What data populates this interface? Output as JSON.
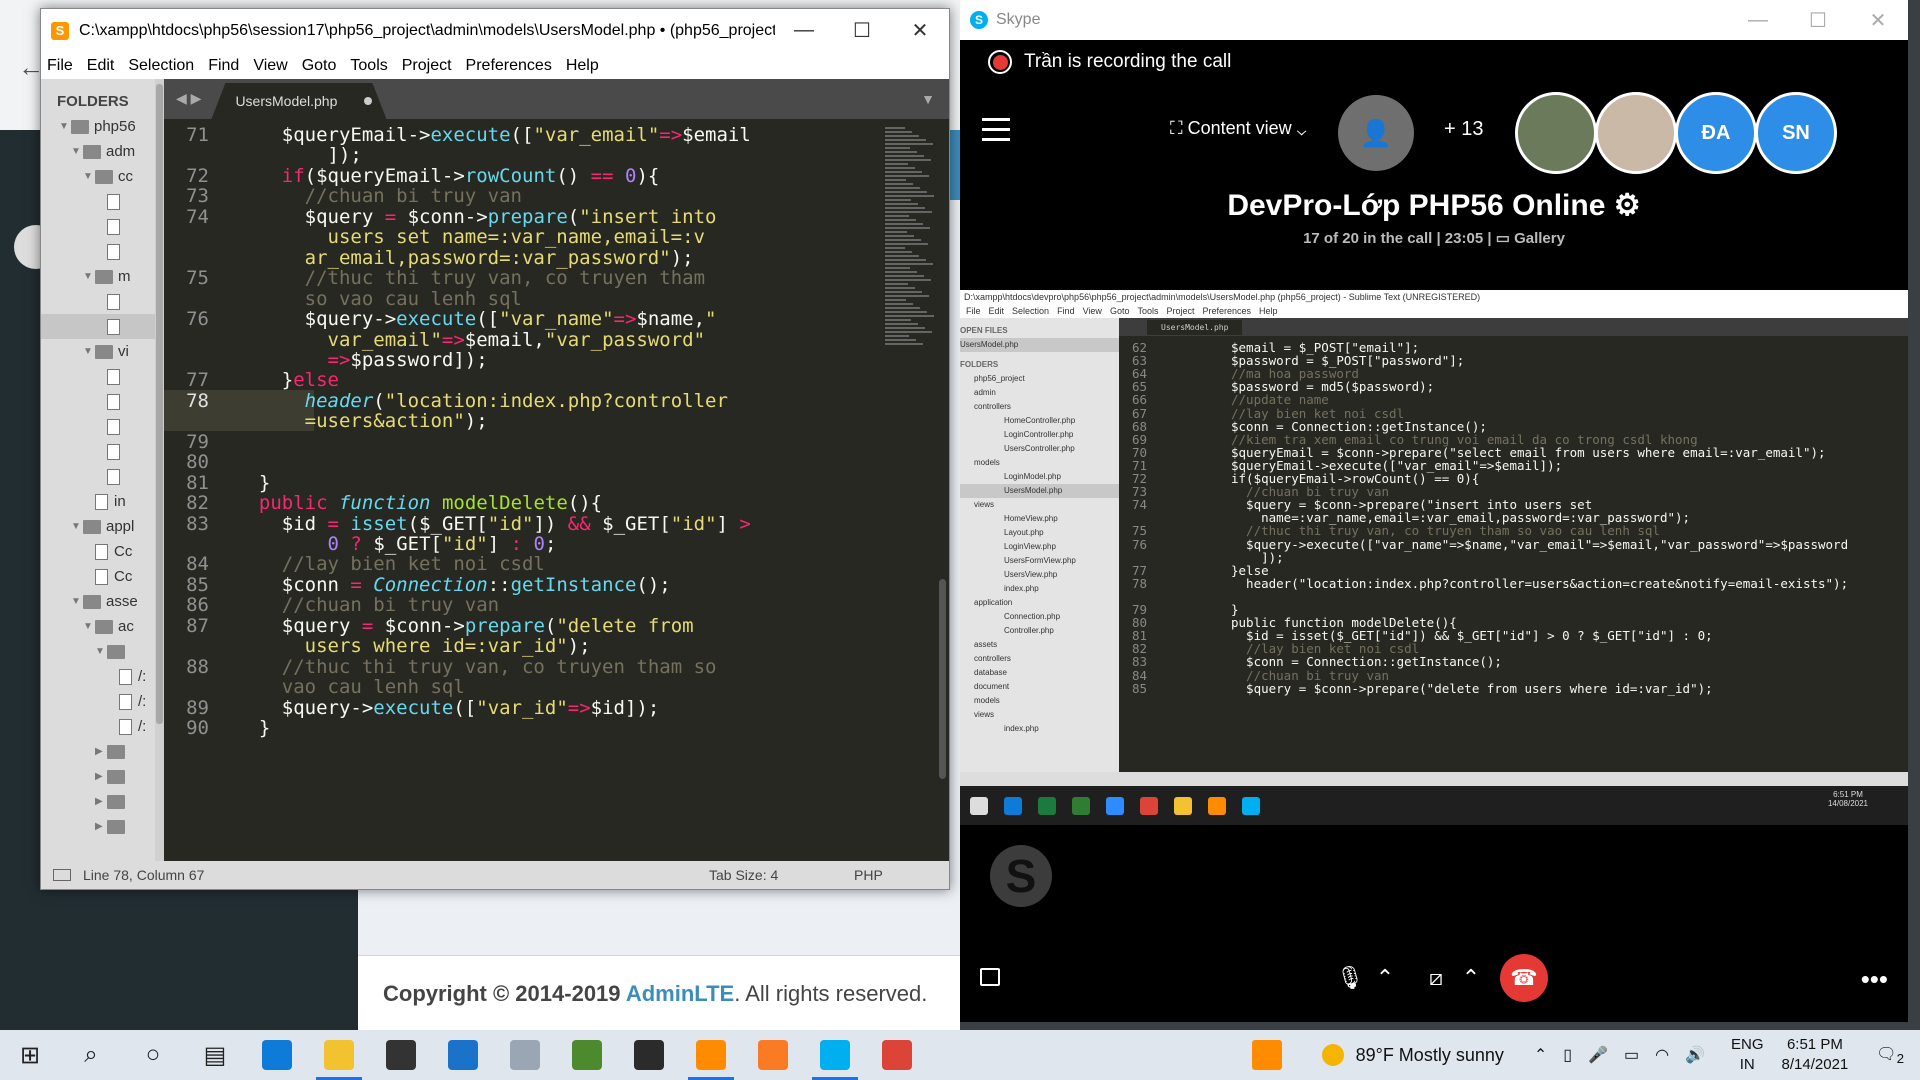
{
  "background_page": {
    "footer_copyright": "Copyright © 2014-2019",
    "footer_brand": "AdminLTE",
    "footer_rest": ". All rights reserved."
  },
  "sublime": {
    "title": "C:\\xampp\\htdocs\\php56\\session17\\php56_project\\admin\\models\\UsersModel.php • (php56_project) - S...",
    "menu": [
      "File",
      "Edit",
      "Selection",
      "Find",
      "View",
      "Goto",
      "Tools",
      "Project",
      "Preferences",
      "Help"
    ],
    "folders_label": "FOLDERS",
    "tree": [
      {
        "label": "php56",
        "type": "folder",
        "depth": 0,
        "open": true
      },
      {
        "label": "adm",
        "type": "folder",
        "depth": 1,
        "open": true
      },
      {
        "label": "cc",
        "type": "folder",
        "depth": 2,
        "open": true
      },
      {
        "label": "",
        "type": "file",
        "depth": 3
      },
      {
        "label": "",
        "type": "file",
        "depth": 3
      },
      {
        "label": "",
        "type": "file",
        "depth": 3
      },
      {
        "label": "m",
        "type": "folder",
        "depth": 2,
        "open": true
      },
      {
        "label": "",
        "type": "file",
        "depth": 3
      },
      {
        "label": "",
        "type": "file",
        "depth": 3,
        "selected": true
      },
      {
        "label": "vi",
        "type": "folder",
        "depth": 2,
        "open": true
      },
      {
        "label": "",
        "type": "file",
        "depth": 3
      },
      {
        "label": "",
        "type": "file",
        "depth": 3
      },
      {
        "label": "",
        "type": "file",
        "depth": 3
      },
      {
        "label": "",
        "type": "file",
        "depth": 3
      },
      {
        "label": "",
        "type": "file",
        "depth": 3
      },
      {
        "label": "in",
        "type": "file",
        "depth": 2
      },
      {
        "label": "appl",
        "type": "folder",
        "depth": 1,
        "open": true
      },
      {
        "label": "Cc",
        "type": "file",
        "depth": 2
      },
      {
        "label": "Cc",
        "type": "file",
        "depth": 2
      },
      {
        "label": "asse",
        "type": "folder",
        "depth": 1,
        "open": true
      },
      {
        "label": "ac",
        "type": "folder",
        "depth": 2,
        "open": true
      },
      {
        "label": "",
        "type": "folder",
        "depth": 3,
        "open": true
      },
      {
        "label": "/:",
        "type": "file",
        "depth": 4
      },
      {
        "label": "/:",
        "type": "file",
        "depth": 4
      },
      {
        "label": "/:",
        "type": "file",
        "depth": 4
      },
      {
        "label": "",
        "type": "folder",
        "depth": 3,
        "open": false
      },
      {
        "label": "",
        "type": "folder",
        "depth": 3,
        "open": false
      },
      {
        "label": "",
        "type": "folder",
        "depth": 3,
        "open": false
      },
      {
        "label": "",
        "type": "folder",
        "depth": 3,
        "open": false
      }
    ],
    "tab_label": "UsersModel.php",
    "status_position": "Line 78, Column 67",
    "status_tab_size": "Tab Size: 4",
    "status_syntax": "PHP",
    "code_lines": [
      {
        "ln": "71",
        "html": "    $queryEmail-><span class=\"f\">execute</span>([<span class=\"s\">\"var_email\"</span><span class=\"k\">=></span>$email"
      },
      {
        "ln": "",
        "html": "        ]);"
      },
      {
        "ln": "72",
        "html": "    <span class=\"k\">if</span>($queryEmail-><span class=\"f\">rowCount</span>() <span class=\"k\">==</span> <span class=\"n\">0</span>){"
      },
      {
        "ln": "73",
        "html": "      <span class=\"c\">//chuan bi truy van</span>"
      },
      {
        "ln": "74",
        "html": "      $query <span class=\"k\">=</span> $conn-><span class=\"f\">prepare</span>(<span class=\"s\">\"insert into</span>"
      },
      {
        "ln": "",
        "html": "<span class=\"s\">        users set name=:var_name,email=:v</span>"
      },
      {
        "ln": "",
        "html": "<span class=\"s\">      ar_email,password=:var_password\"</span>);"
      },
      {
        "ln": "75",
        "html": "      <span class=\"c\">//thuc thi truy van, co truyen tham</span>"
      },
      {
        "ln": "",
        "html": "<span class=\"c\">      so vao cau lenh sql</span>"
      },
      {
        "ln": "76",
        "html": "      $query-><span class=\"f\">execute</span>([<span class=\"s\">\"var_name\"</span><span class=\"k\">=></span>$name,<span class=\"s\">\"</span>"
      },
      {
        "ln": "",
        "html": "<span class=\"s\">        var_email\"</span><span class=\"k\">=></span>$email,<span class=\"s\">\"var_password\"</span>"
      },
      {
        "ln": "",
        "html": "        <span class=\"k\">=></span>$password]);"
      },
      {
        "ln": "77",
        "html": "    }<span class=\"k\">else</span>"
      },
      {
        "ln": "78",
        "html": "      <span class=\"fi\">header</span>(<span class=\"s\">\"location:index.php?controller</span>"
      },
      {
        "ln": "",
        "html": "<span class=\"s\">      =users&amp;action\"</span>);"
      },
      {
        "ln": "79",
        "html": ""
      },
      {
        "ln": "80",
        "html": ""
      },
      {
        "ln": "81",
        "html": "  }"
      },
      {
        "ln": "82",
        "html": "  <span class=\"k\">public</span> <span class=\"fi\">function</span> <span class=\"fn\">modelDelete</span>(){"
      },
      {
        "ln": "83",
        "html": "    $id <span class=\"k\">=</span> <span class=\"f\">isset</span>($_GET[<span class=\"s\">\"id\"</span>]) <span class=\"k\">&amp;&amp;</span> $_GET[<span class=\"s\">\"id\"</span>] <span class=\"k\">></span>"
      },
      {
        "ln": "",
        "html": "        <span class=\"n\">0</span> <span class=\"k\">?</span> $_GET[<span class=\"s\">\"id\"</span>] <span class=\"k\">:</span> <span class=\"n\">0</span>;"
      },
      {
        "ln": "84",
        "html": "    <span class=\"c\">//lay bien ket noi csdl</span>"
      },
      {
        "ln": "85",
        "html": "    $conn <span class=\"k\">=</span> <span class=\"cls\">Connection</span>::<span class=\"f\">getInstance</span>();"
      },
      {
        "ln": "86",
        "html": "    <span class=\"c\">//chuan bi truy van</span>"
      },
      {
        "ln": "87",
        "html": "    $query <span class=\"k\">=</span> $conn-><span class=\"f\">prepare</span>(<span class=\"s\">\"delete from</span>"
      },
      {
        "ln": "",
        "html": "<span class=\"s\">      users where id=:var_id\"</span>);"
      },
      {
        "ln": "88",
        "html": "    <span class=\"c\">//thuc thi truy van, co truyen tham so</span>"
      },
      {
        "ln": "",
        "html": "<span class=\"c\">    vao cau lenh sql</span>"
      },
      {
        "ln": "89",
        "html": "    $query-><span class=\"f\">execute</span>([<span class=\"s\">\"var_id\"</span><span class=\"k\">=></span>$id]);"
      },
      {
        "ln": "90",
        "html": "  }"
      }
    ]
  },
  "skype": {
    "title": "Skype",
    "recording_text": "Trần is recording the call",
    "content_view_label": "Content view",
    "participants_more": "+ 13",
    "avatars": [
      {
        "initials": "",
        "color": "#6b7a5a"
      },
      {
        "initials": "",
        "color": "#c9b9a6"
      },
      {
        "initials": "ĐA",
        "color": "#2e8de6"
      },
      {
        "initials": "SN",
        "color": "#2e8de6"
      }
    ],
    "meeting_title": "DevPro-Lớp PHP56 Online",
    "meeting_status": "17 of 20 in the call | 23:05 |",
    "meeting_view": "Gallery",
    "shared_screen": {
      "title": "D:\\xampp\\htdocs\\devpro\\php56\\php56_project\\admin\\models\\UsersModel.php (php56_project) - Sublime Text (UNREGISTERED)",
      "menu": [
        "File",
        "Edit",
        "Selection",
        "Find",
        "View",
        "Goto",
        "Tools",
        "Project",
        "Preferences",
        "Help"
      ],
      "open_files_label": "OPEN FILES",
      "open_file": "UsersModel.php",
      "folders_label": "FOLDERS",
      "tree": [
        "php56_project",
        "admin",
        "controllers",
        "HomeController.php",
        "LoginController.php",
        "UsersController.php",
        "models",
        "LoginModel.php",
        "UsersModel.php",
        "views",
        "HomeView.php",
        "Layout.php",
        "LoginView.php",
        "UsersFormView.php",
        "UsersView.php",
        "index.php",
        "application",
        "Connection.php",
        "Controller.php",
        "assets",
        "controllers",
        "database",
        "document",
        "models",
        "views",
        "index.php"
      ],
      "tab_label": "UsersModel.php",
      "clock_time": "6:51 PM",
      "clock_date": "14/08/2021",
      "code_lines": [
        {
          "ln": "62",
          "text": "$email = $_POST[\"email\"];"
        },
        {
          "ln": "63",
          "text": "$password = $_POST[\"password\"];"
        },
        {
          "ln": "64",
          "text": "//ma hoa password"
        },
        {
          "ln": "65",
          "text": "$password = md5($password);"
        },
        {
          "ln": "66",
          "text": "//update name"
        },
        {
          "ln": "67",
          "text": "//lay bien ket noi csdl"
        },
        {
          "ln": "68",
          "text": "$conn = Connection::getInstance();"
        },
        {
          "ln": "69",
          "text": "//kiem tra xem email co trung voi email da co trong csdl khong"
        },
        {
          "ln": "70",
          "text": "$queryEmail = $conn->prepare(\"select email from users where email=:var_email\");"
        },
        {
          "ln": "71",
          "text": "$queryEmail->execute([\"var_email\"=>$email]);"
        },
        {
          "ln": "72",
          "text": "if($queryEmail->rowCount() == 0){"
        },
        {
          "ln": "73",
          "text": "  //chuan bi truy van"
        },
        {
          "ln": "74",
          "text": "  $query = $conn->prepare(\"insert into users set"
        },
        {
          "ln": "",
          "text": "    name=:var_name,email=:var_email,password=:var_password\");"
        },
        {
          "ln": "75",
          "text": "  //thuc thi truy van, co truyen tham so vao cau lenh sql"
        },
        {
          "ln": "76",
          "text": "  $query->execute([\"var_name\"=>$name,\"var_email\"=>$email,\"var_password\"=>$password"
        },
        {
          "ln": "",
          "text": "    ]);"
        },
        {
          "ln": "77",
          "text": "}else"
        },
        {
          "ln": "78",
          "text": "  header(\"location:index.php?controller=users&action=create&notify=email-exists\");"
        },
        {
          "ln": "",
          "text": ""
        },
        {
          "ln": "79",
          "text": "}"
        },
        {
          "ln": "80",
          "text": "public function modelDelete(){"
        },
        {
          "ln": "81",
          "text": "  $id = isset($_GET[\"id\"]) && $_GET[\"id\"] > 0 ? $_GET[\"id\"] : 0;"
        },
        {
          "ln": "82",
          "text": "  //lay bien ket noi csdl"
        },
        {
          "ln": "83",
          "text": "  $conn = Connection::getInstance();"
        },
        {
          "ln": "84",
          "text": "  //chuan bi truy van"
        },
        {
          "ln": "85",
          "text": "  $query = $conn->prepare(\"delete from users where id=:var_id\");"
        }
      ]
    }
  },
  "taskbar": {
    "weather": "89°F  Mostly sunny",
    "lang_top": "ENG",
    "lang_bottom": "IN",
    "time": "6:51 PM",
    "date": "8/14/2021",
    "notification_count": "2",
    "apps": [
      {
        "name": "search-icon",
        "glyph": "⌕"
      },
      {
        "name": "cortana-icon",
        "glyph": "○"
      },
      {
        "name": "task-view-icon",
        "glyph": "▤"
      },
      {
        "name": "edge-icon",
        "color": "#0f7bd8"
      },
      {
        "name": "file-explorer-icon",
        "color": "#f2c230",
        "active": true
      },
      {
        "name": "store-icon",
        "color": "#333"
      },
      {
        "name": "mail-icon",
        "color": "#1a73c9"
      },
      {
        "name": "dropbox-icon",
        "color": "#9aa6b4"
      },
      {
        "name": "evernote-icon",
        "color": "#4d8a2e"
      },
      {
        "name": "tripadvisor-icon",
        "color": "#2b2b2b"
      },
      {
        "name": "sublime-icon",
        "color": "#ff8c00",
        "active": true
      },
      {
        "name": "xampp-icon",
        "color": "#fb7a24"
      },
      {
        "name": "skype-icon",
        "color": "#00aff0",
        "active": true
      },
      {
        "name": "chrome-icon",
        "color": "#db4437"
      }
    ]
  }
}
